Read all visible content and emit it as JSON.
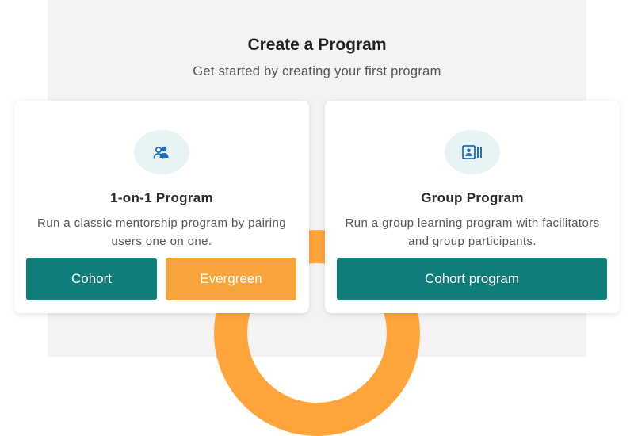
{
  "page": {
    "title": "Create a Program",
    "subtitle": "Get started by creating your first program"
  },
  "cards": [
    {
      "icon": "users-icon",
      "title": "1-on-1 Program",
      "description": "Run a classic mentorship program by pairing users one on one.",
      "buttons": [
        {
          "label": "Cohort",
          "color": "#0f7d7a"
        },
        {
          "label": "Evergreen",
          "color": "#f8a43c"
        }
      ]
    },
    {
      "icon": "group-board-icon",
      "title": "Group Program",
      "description": "Run a group learning program with facilitators and group participants.",
      "buttons": [
        {
          "label": "Cohort program",
          "color": "#0f7d7a"
        }
      ]
    }
  ],
  "colors": {
    "accent_teal": "#0f7d7a",
    "accent_orange": "#f8a43c",
    "icon_blue": "#1b6fbf",
    "icon_bg": "#e8f3f6",
    "ring_orange": "#ffa53c"
  }
}
